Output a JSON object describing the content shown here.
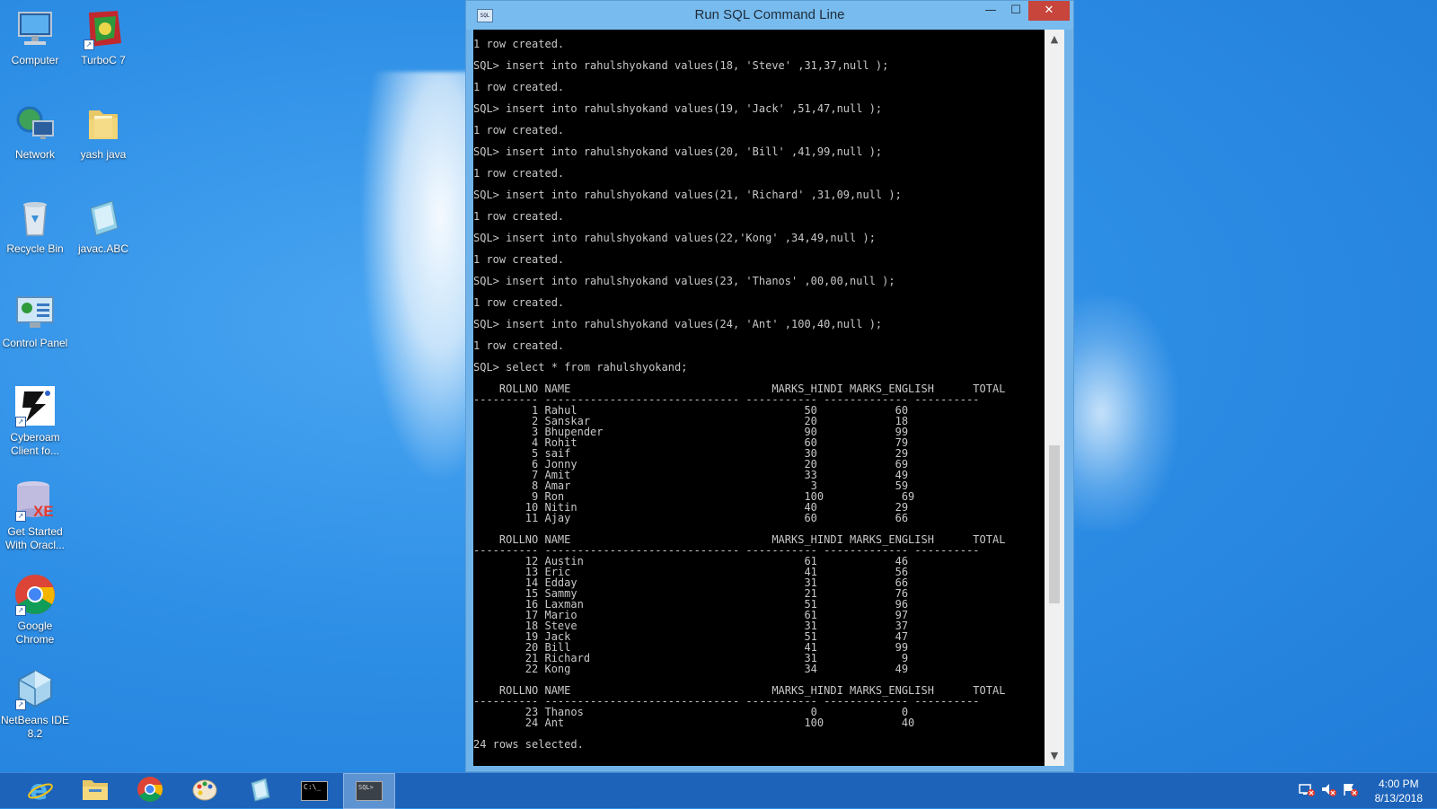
{
  "window": {
    "title": "Run SQL Command Line",
    "icon_label": "SQL",
    "minimize_glyph": "—",
    "maximize_glyph": "☐",
    "close_glyph": "✕"
  },
  "desktop_icons": [
    {
      "label": "Computer",
      "icon": "computer-icon"
    },
    {
      "label": "TurboC 7",
      "icon": "turboc-icon"
    },
    {
      "label": "Network",
      "icon": "network-icon"
    },
    {
      "label": "yash java",
      "icon": "folder-icon"
    },
    {
      "label": "Recycle Bin",
      "icon": "recycle-bin-icon"
    },
    {
      "label": "javac.ABC",
      "icon": "notepad-file-icon"
    },
    {
      "label": "Control Panel",
      "icon": "control-panel-icon"
    },
    {
      "label": "Cyberoam\nClient fo...",
      "icon": "cyberoam-icon"
    },
    {
      "label": "Get Started\nWith Oracl...",
      "icon": "oracle-xe-icon"
    },
    {
      "label": "Google\nChrome",
      "icon": "chrome-icon"
    },
    {
      "label": "NetBeans IDE\n8.2",
      "icon": "netbeans-icon"
    }
  ],
  "console": {
    "lines": [
      "1 row created.",
      "",
      "SQL> insert into rahulshyokand values(18, 'Steve' ,31,37,null );",
      "",
      "1 row created.",
      "",
      "SQL> insert into rahulshyokand values(19, 'Jack' ,51,47,null );",
      "",
      "1 row created.",
      "",
      "SQL> insert into rahulshyokand values(20, 'Bill' ,41,99,null );",
      "",
      "1 row created.",
      "",
      "SQL> insert into rahulshyokand values(21, 'Richard' ,31,09,null );",
      "",
      "1 row created.",
      "",
      "SQL> insert into rahulshyokand values(22,'Kong' ,34,49,null );",
      "",
      "1 row created.",
      "",
      "SQL> insert into rahulshyokand values(23, 'Thanos' ,00,00,null );",
      "",
      "1 row created.",
      "",
      "SQL> insert into rahulshyokand values(24, 'Ant' ,100,40,null );",
      "",
      "1 row created.",
      "",
      "SQL> select * from rahulshyokand;",
      "",
      "    ROLLNO NAME                               MARKS_HINDI MARKS_ENGLISH      TOTAL",
      "---------- ------------------------------ ----------- ------------- ----------",
      "         1 Rahul                                   50            60",
      "         2 Sanskar                                 20            18",
      "         3 Bhupender                               90            99",
      "         4 Rohit                                   60            79",
      "         5 saif                                    30            29",
      "         6 Jonny                                   20            69",
      "         7 Amit                                    33            49",
      "         8 Amar                                     3            59",
      "         9 Ron                                     100            69",
      "        10 Nitin                                   40            29",
      "        11 Ajay                                    60            66",
      "",
      "    ROLLNO NAME                               MARKS_HINDI MARKS_ENGLISH      TOTAL",
      "---------- ------------------------------ ----------- ------------- ----------",
      "        12 Austin                                  61            46",
      "        13 Eric                                    41            56",
      "        14 Edday                                   31            66",
      "        15 Sammy                                   21            76",
      "        16 Laxman                                  51            96",
      "        17 Mario                                   61            97",
      "        18 Steve                                   31            37",
      "        19 Jack                                    51            47",
      "        20 Bill                                    41            99",
      "        21 Richard                                 31             9",
      "        22 Kong                                    34            49",
      "",
      "    ROLLNO NAME                               MARKS_HINDI MARKS_ENGLISH      TOTAL",
      "---------- ------------------------------ ----------- ------------- ----------",
      "        23 Thanos                                   0             0",
      "        24 Ant                                     100            40",
      "",
      "24 rows selected."
    ]
  },
  "taskbar": {
    "apps": [
      {
        "name": "internet-explorer",
        "icon": "ie-icon"
      },
      {
        "name": "file-explorer",
        "icon": "folder-icon"
      },
      {
        "name": "google-chrome",
        "icon": "chrome-icon"
      },
      {
        "name": "paint",
        "icon": "paint-palette-icon"
      },
      {
        "name": "notepad",
        "icon": "notepad-icon"
      },
      {
        "name": "command-prompt",
        "icon": "cmd-icon",
        "label": "C:\\_"
      },
      {
        "name": "run-sql-command-line",
        "icon": "sql-icon",
        "label": "SQL>",
        "active": true
      }
    ],
    "time": "4:00 PM",
    "date": "8/13/2018"
  }
}
